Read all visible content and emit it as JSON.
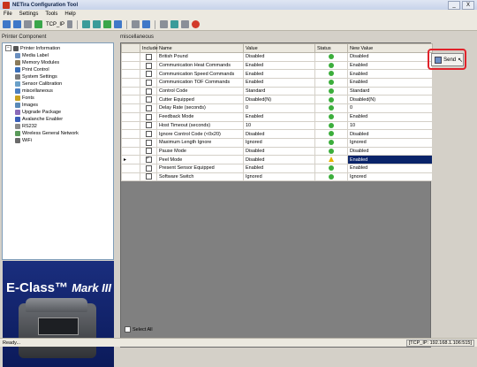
{
  "window": {
    "title": "NETira Configuration Tool",
    "controls": [
      "_",
      "X"
    ]
  },
  "menu": [
    "File",
    "Settings",
    "Tools",
    "Help"
  ],
  "toolbar": {
    "connection": "TCP_IP"
  },
  "left_panel": {
    "header": "Printer Component",
    "tree": [
      {
        "label": "Printer Information",
        "level": 0,
        "expanded": true,
        "icon": "printer-icon",
        "color": "#555555"
      },
      {
        "label": "Media Label",
        "level": 1,
        "icon": "media-icon",
        "color": "#6a8fbf"
      },
      {
        "label": "Memory Modules",
        "level": 1,
        "icon": "memory-icon",
        "color": "#8a7a5a"
      },
      {
        "label": "Print Control",
        "level": 1,
        "icon": "print-control-icon",
        "color": "#3a6fb8"
      },
      {
        "label": "System Settings",
        "level": 1,
        "icon": "settings-icon",
        "color": "#7a7a7a"
      },
      {
        "label": "Sensor Calibration",
        "level": 1,
        "icon": "sensor-icon",
        "color": "#6aa0c8"
      },
      {
        "label": "miscellaneous",
        "level": 1,
        "icon": "misc-icon",
        "color": "#4c7fc2"
      },
      {
        "label": "Fonts",
        "level": 1,
        "icon": "fonts-icon",
        "color": "#c8a020"
      },
      {
        "label": "Images",
        "level": 1,
        "icon": "images-icon",
        "color": "#5a8ab8"
      },
      {
        "label": "Upgrade Package",
        "level": 1,
        "icon": "upgrade-icon",
        "color": "#8a6ab8"
      },
      {
        "label": "Avalanche Enabler",
        "level": 1,
        "icon": "avalanche-icon",
        "color": "#3a5fb8"
      },
      {
        "label": "RS232",
        "level": 1,
        "icon": "rs232-icon",
        "color": "#8a8a8a"
      },
      {
        "label": "Wireless General Network",
        "level": 1,
        "icon": "wireless-icon",
        "color": "#5a9a5a"
      },
      {
        "label": "WiFi",
        "level": 1,
        "icon": "wifi-icon",
        "color": "#6a6a6a"
      }
    ],
    "banner": {
      "brand": "E-Class",
      "model": "Mark III"
    }
  },
  "main": {
    "header": "miscellaneous",
    "columns": [
      "Include",
      "Name",
      "Value",
      "Status",
      "New Value"
    ],
    "rows": [
      {
        "include": false,
        "name": "British Pound",
        "value": "Disabled",
        "status": "ok",
        "new_value": "Disabled",
        "selected": false
      },
      {
        "include": false,
        "name": "Communication Heat Commands",
        "value": "Enabled",
        "status": "ok",
        "new_value": "Enabled",
        "selected": false
      },
      {
        "include": false,
        "name": "Communication Speed Commands",
        "value": "Enabled",
        "status": "ok",
        "new_value": "Enabled",
        "selected": false
      },
      {
        "include": false,
        "name": "Communication TOF Commands",
        "value": "Enabled",
        "status": "ok",
        "new_value": "Enabled",
        "selected": false
      },
      {
        "include": false,
        "name": "Control Code",
        "value": "Standard",
        "status": "ok",
        "new_value": "Standard",
        "selected": false
      },
      {
        "include": false,
        "name": "Cutter Equipped",
        "value": "Disabled(N)",
        "status": "ok",
        "new_value": "Disabled(N)",
        "selected": false
      },
      {
        "include": false,
        "name": "Delay Rate (seconds)",
        "value": "0",
        "status": "ok",
        "new_value": "0",
        "selected": false
      },
      {
        "include": false,
        "name": "Feedback Mode",
        "value": "Enabled",
        "status": "ok",
        "new_value": "Enabled",
        "selected": false
      },
      {
        "include": false,
        "name": "Host Timeout (seconds)",
        "value": "10",
        "status": "ok",
        "new_value": "10",
        "selected": false
      },
      {
        "include": false,
        "name": "Ignore Control Code (<0x20)",
        "value": "Disabled",
        "status": "ok",
        "new_value": "Disabled",
        "selected": false
      },
      {
        "include": false,
        "name": "Maximum Length Ignore",
        "value": "Ignored",
        "status": "ok",
        "new_value": "Ignored",
        "selected": false
      },
      {
        "include": false,
        "name": "Pause Mode",
        "value": "Disabled",
        "status": "ok",
        "new_value": "Disabled",
        "selected": false
      },
      {
        "include": true,
        "name": "Peel Mode",
        "value": "Disabled",
        "status": "warn",
        "new_value": "Enabled",
        "selected": true
      },
      {
        "include": false,
        "name": "Present Sensor Equipped",
        "value": "Enabled",
        "status": "ok",
        "new_value": "Enabled",
        "selected": false
      },
      {
        "include": false,
        "name": "Software Switch",
        "value": "Ignored",
        "status": "ok",
        "new_value": "Ignored",
        "selected": false
      }
    ],
    "select_all": "Select All"
  },
  "send_button": {
    "label": "Send"
  },
  "statusbar": {
    "left": "Ready...",
    "right": "[TCP_IP: 192.168.1.106:515]"
  },
  "colors": {
    "selection": "#0a246a",
    "status_ok": "#3cae3c",
    "status_warn": "#e3b200",
    "highlight": "#e0222a"
  }
}
